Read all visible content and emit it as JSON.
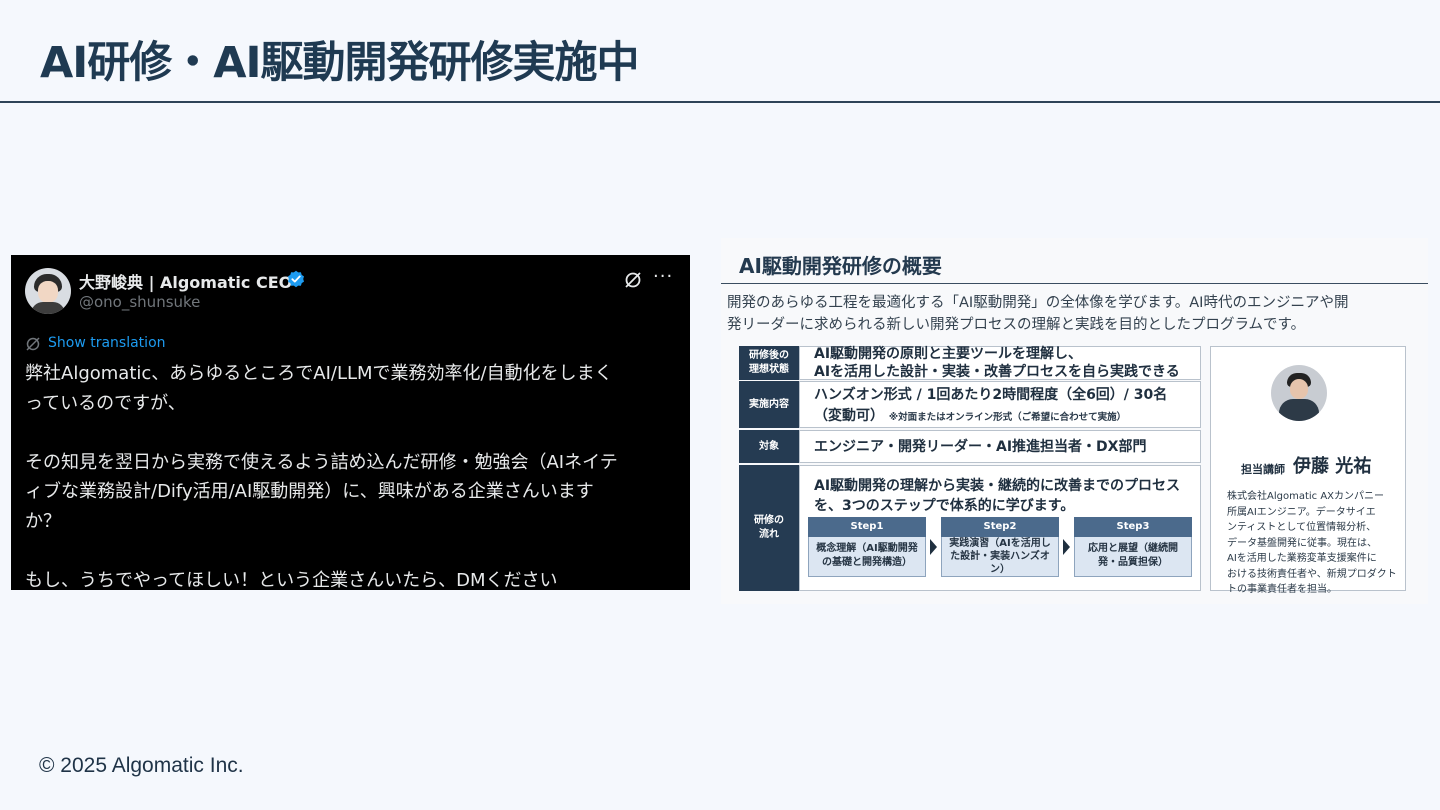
{
  "slide": {
    "title": "AI研修・AI駆動開発研修実施中",
    "copyright": "© 2025 Algomatic Inc."
  },
  "tweet": {
    "author_name": "大野峻典 | Algomatic CEO",
    "handle": "@ono_shunsuke",
    "more_label": "···",
    "translate_label": "Show translation",
    "body_lines": [
      "弊社Algomatic、あらゆるところでAI/LLMで業務効率化/自動化をしまく",
      "っているのですが、",
      "",
      "その知見を翌日から実務で使えるよう詰め込んだ研修・勉強会（AIネイテ",
      "ィブな業務設計/Dify活用/AI駆動開発）に、興味がある企業さんいます",
      "か？",
      "",
      "もし、うちでやってほしい！という企業さんいたら、DMください"
    ],
    "verified_color": "#1d9bf0",
    "link_color": "#1d9bf0"
  },
  "overview": {
    "title": "AI駆動開発研修の概要",
    "description": [
      "開発のあらゆる工程を最適化する「AI駆動開発」の全体像を学びます。AI時代のエンジニアや開",
      "発リーダーに求められる新しい開発プロセスの理解と実践を目的としたプログラムです。"
    ],
    "rows": [
      {
        "label_lines": [
          "研修後の",
          "理想状態"
        ],
        "text_lines": [
          "AI駆動開発の原則と主要ツールを理解し、",
          "AIを活用した設計・実装・改善プロセスを自ら実践できる"
        ]
      },
      {
        "label_lines": [
          "実施内容"
        ],
        "text_lines": [
          "ハンズオン形式 / 1回あたり2時間程度（全6回）/ 30名",
          "（変動可）"
        ],
        "note": "※対面またはオンライン形式（ご希望に合わせて実施）"
      },
      {
        "label_lines": [
          "対象"
        ],
        "text_lines": [
          "エンジニア・開発リーダー・AI推進担当者・DX部門"
        ]
      },
      {
        "label_lines": [
          "研修の",
          "流れ"
        ],
        "text_lines": [
          "AI駆動開発の理解から実装・継続的に改善までのプロセス",
          "を、3つのステップで体系的に学びます。"
        ]
      }
    ],
    "steps": [
      {
        "title": "Step1",
        "lines": [
          "概念理解（AI駆動開発",
          "の基礎と開発構造）"
        ]
      },
      {
        "title": "Step2",
        "lines": [
          "実践演習（AIを活用し",
          "た設計・実装ハンズオ",
          "ン）"
        ]
      },
      {
        "title": "Step3",
        "lines": [
          "応用と展望（継続開",
          "発・品質担保）"
        ]
      }
    ],
    "instructor": {
      "role": "担当講師",
      "name": "伊藤 光祐",
      "bio_lines": [
        "株式会社Algomatic AXカンパニー",
        "所属AIエンジニア。データサイエ",
        "ンティストとして位置情報分析、",
        "データ基盤開発に従事。現在は、",
        "AIを活用した業務変革支援案件に",
        "おける技術責任者や、新規プロダクト",
        "トの事業責任者を担当。"
      ]
    },
    "colors": {
      "label_bg": "#253b52",
      "step_head_bg": "#4b6a8c",
      "step_body_bg": "#dce6f2"
    }
  }
}
